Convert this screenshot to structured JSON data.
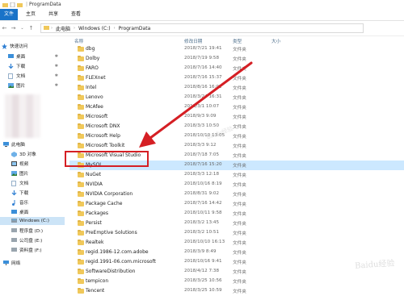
{
  "titlebar": {
    "path_label": "ProgramData"
  },
  "ribbon": {
    "tabs": [
      "文件",
      "主页",
      "共享",
      "查看"
    ]
  },
  "address": {
    "crumbs": [
      "此电脑",
      "Windows (C:)",
      "ProgramData"
    ]
  },
  "sidebar": {
    "items": [
      {
        "label": "快速访问",
        "icon": "star-icon"
      },
      {
        "label": "桌面",
        "icon": "desktop-icon"
      },
      {
        "label": "下载",
        "icon": "download-icon"
      },
      {
        "label": "文档",
        "icon": "document-icon"
      },
      {
        "label": "图片",
        "icon": "picture-icon"
      },
      {
        "label": "此电脑",
        "icon": "computer-icon"
      },
      {
        "label": "3D 对象",
        "icon": "cube-icon"
      },
      {
        "label": "视频",
        "icon": "video-icon"
      },
      {
        "label": "图片",
        "icon": "picture-icon"
      },
      {
        "label": "文档",
        "icon": "document-icon"
      },
      {
        "label": "下载",
        "icon": "download-icon"
      },
      {
        "label": "音乐",
        "icon": "music-icon"
      },
      {
        "label": "桌面",
        "icon": "desktop-icon"
      },
      {
        "label": "Windows (C:)",
        "icon": "drive-icon"
      },
      {
        "label": "程序盘 (D:)",
        "icon": "drive-icon"
      },
      {
        "label": "公司盘 (E:)",
        "icon": "drive-icon"
      },
      {
        "label": "资料盘 (F:)",
        "icon": "drive-icon"
      },
      {
        "label": "网络",
        "icon": "network-icon"
      }
    ]
  },
  "columns": {
    "name": "名称",
    "date": "修改日期",
    "type": "类型",
    "size": "大小"
  },
  "files": [
    {
      "name": "dbg",
      "date": "2018/7/21 19:41",
      "type": "文件夹"
    },
    {
      "name": "Dolby",
      "date": "2018/7/19 9:58",
      "type": "文件夹"
    },
    {
      "name": "FARO",
      "date": "2018/7/16 14:40",
      "type": "文件夹"
    },
    {
      "name": "FLEXnet",
      "date": "2018/7/16 15:37",
      "type": "文件夹"
    },
    {
      "name": "Intel",
      "date": "2018/8/16 16:02",
      "type": "文件夹"
    },
    {
      "name": "Lenovo",
      "date": "2018/3/24 16:31",
      "type": "文件夹"
    },
    {
      "name": "McAfee",
      "date": "2018/3/1 10:07",
      "type": "文件夹"
    },
    {
      "name": "Microsoft",
      "date": "2018/9/3 9:09",
      "type": "文件夹"
    },
    {
      "name": "Microsoft DNX",
      "date": "2018/3/3 10:50",
      "type": "文件夹"
    },
    {
      "name": "Microsoft Help",
      "date": "2018/10/10 13:05",
      "type": "文件夹"
    },
    {
      "name": "Microsoft Toolkit",
      "date": "2018/3/3 9:12",
      "type": "文件夹"
    },
    {
      "name": "Microsoft Visual Studio",
      "date": "2018/7/18 7:05",
      "type": "文件夹"
    },
    {
      "name": "MySQL",
      "date": "2018/7/16 15:20",
      "type": "文件夹",
      "selected": true
    },
    {
      "name": "NuGet",
      "date": "2018/3/3 12:18",
      "type": "文件夹"
    },
    {
      "name": "NVIDIA",
      "date": "2018/10/16 8:19",
      "type": "文件夹"
    },
    {
      "name": "NVIDIA Corporation",
      "date": "2018/8/31 9:02",
      "type": "文件夹"
    },
    {
      "name": "Package Cache",
      "date": "2018/7/16 14:42",
      "type": "文件夹"
    },
    {
      "name": "Packages",
      "date": "2018/10/11 9:58",
      "type": "文件夹"
    },
    {
      "name": "Persist",
      "date": "2018/3/2 13:45",
      "type": "文件夹"
    },
    {
      "name": "PreEmptive Solutions",
      "date": "2018/3/2 10:51",
      "type": "文件夹"
    },
    {
      "name": "Realtek",
      "date": "2018/10/10 16:13",
      "type": "文件夹"
    },
    {
      "name": "regid.1986-12.com.adobe",
      "date": "2018/3/9 8:49",
      "type": "文件夹"
    },
    {
      "name": "regid.1991-06.com.microsoft",
      "date": "2018/10/16 9:41",
      "type": "文件夹"
    },
    {
      "name": "SoftwareDistribution",
      "date": "2018/4/12 7:38",
      "type": "文件夹"
    },
    {
      "name": "tempicon",
      "date": "2018/3/25 10:56",
      "type": "文件夹"
    },
    {
      "name": "Tencent",
      "date": "2018/3/25 10:59",
      "type": "文件夹"
    }
  ],
  "colors": {
    "selected_row": "#cce8ff",
    "highlight": "#d51f24",
    "folder": "#f0c85a"
  },
  "watermark": "Baidu经验"
}
